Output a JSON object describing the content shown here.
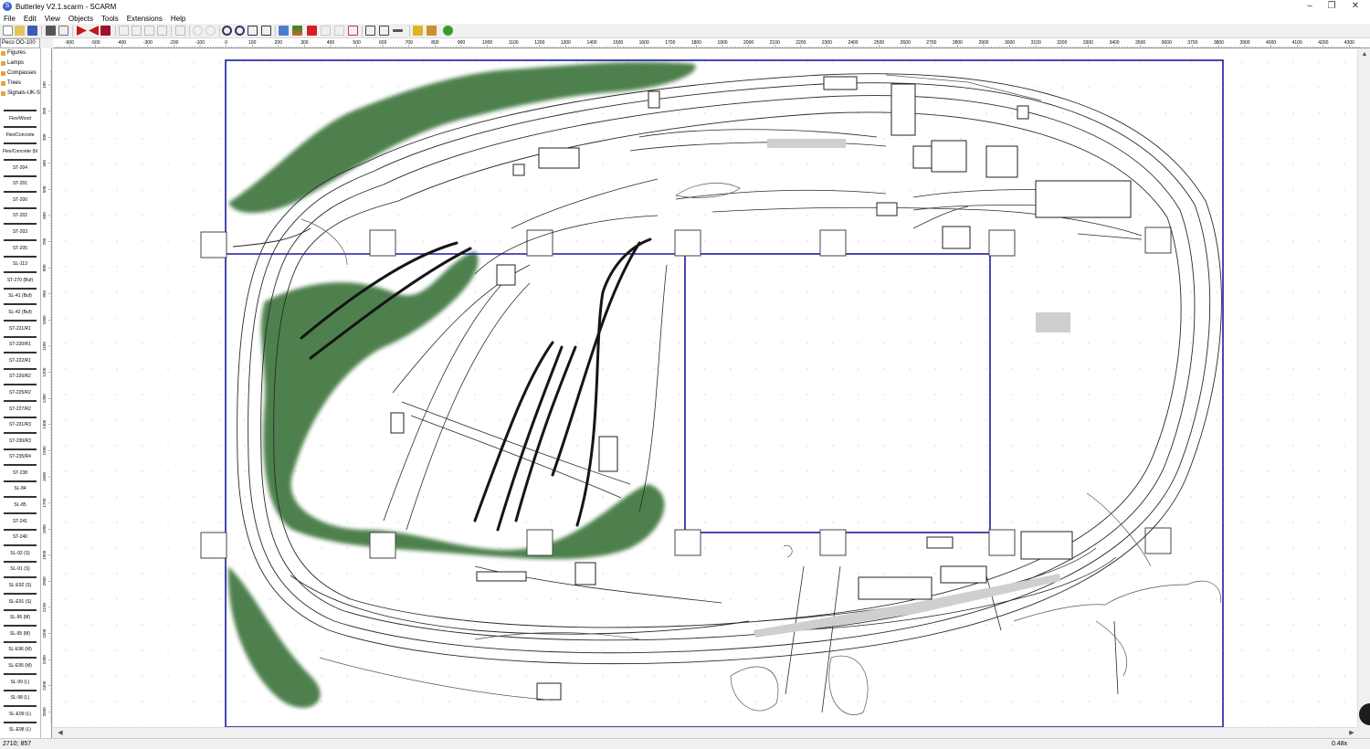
{
  "window": {
    "title": "Butterley V2.1.scarm - SCARM",
    "controls": [
      "–",
      "❐",
      "✕"
    ]
  },
  "menu": [
    "File",
    "Edit",
    "View",
    "Objects",
    "Tools",
    "Extensions",
    "Help"
  ],
  "library": {
    "selected": "Peco OO-100",
    "categories": [
      "Figures",
      "Lamps",
      "Compasses",
      "Trees",
      "Signals-UK-S"
    ],
    "flex": [
      "Flex/Wood",
      "Flex/Concrete",
      "Flex/Concrete (bl"
    ],
    "items": [
      "ST-204",
      "ST-201",
      "ST-200",
      "ST-202",
      "ST-203",
      "ST-205",
      "SL-113",
      "ST-270 (Buf)",
      "SL-41 (Buf)",
      "SL-42 (Buf)",
      "ST-221/R1",
      "ST-220/R1",
      "ST-222/R1",
      "ST-226/R2",
      "ST-225/R2",
      "ST-227/R2",
      "ST-231/R3",
      "ST-230/R3",
      "ST-235/R4",
      "ST-238",
      "SL-84",
      "SL-85",
      "ST-241",
      "ST-240",
      "SL-92 (S)",
      "SL-91 (S)",
      "SL-E92 (S)",
      "SL-E91 (S)",
      "SL-96 (M)",
      "SL-95 (M)",
      "SL-E96 (M)",
      "SL-E95 (M)",
      "SL-99 (L)",
      "SL-98 (L)",
      "SL-E99 (L)",
      "SL-E98 (L)"
    ]
  },
  "ruler": {
    "unit": "mm",
    "h_labels": [
      "-600",
      "-500",
      "-400",
      "-300",
      "-200",
      "-100",
      "0",
      "100",
      "200",
      "300",
      "400",
      "500",
      "600",
      "700",
      "800",
      "900",
      "1000",
      "1100",
      "1200",
      "1300",
      "1400",
      "1500",
      "1600",
      "1700",
      "1800",
      "1900",
      "2000",
      "2100",
      "2200",
      "2300",
      "2400",
      "2500",
      "2600",
      "2700",
      "2800",
      "2900",
      "3000",
      "3100",
      "3200",
      "3300",
      "3400",
      "3500",
      "3600",
      "3700",
      "3800",
      "3900",
      "4000",
      "4100",
      "4200",
      "4300"
    ],
    "v_labels": [
      "100",
      "200",
      "300",
      "400",
      "500",
      "600",
      "700",
      "800",
      "900",
      "1000",
      "1100",
      "1200",
      "1300",
      "1400",
      "1500",
      "1600",
      "1700",
      "1800",
      "1900",
      "2000",
      "2100",
      "2200",
      "2300",
      "2400",
      "2500"
    ]
  },
  "colors": {
    "board_outline": "#1a1aa0",
    "track": "#2a2a2a",
    "trees": "#2d6b2d",
    "canvas_dots": "#b8b8b8"
  },
  "status": {
    "coords": "2710; 857",
    "zoom": "0.48x"
  }
}
